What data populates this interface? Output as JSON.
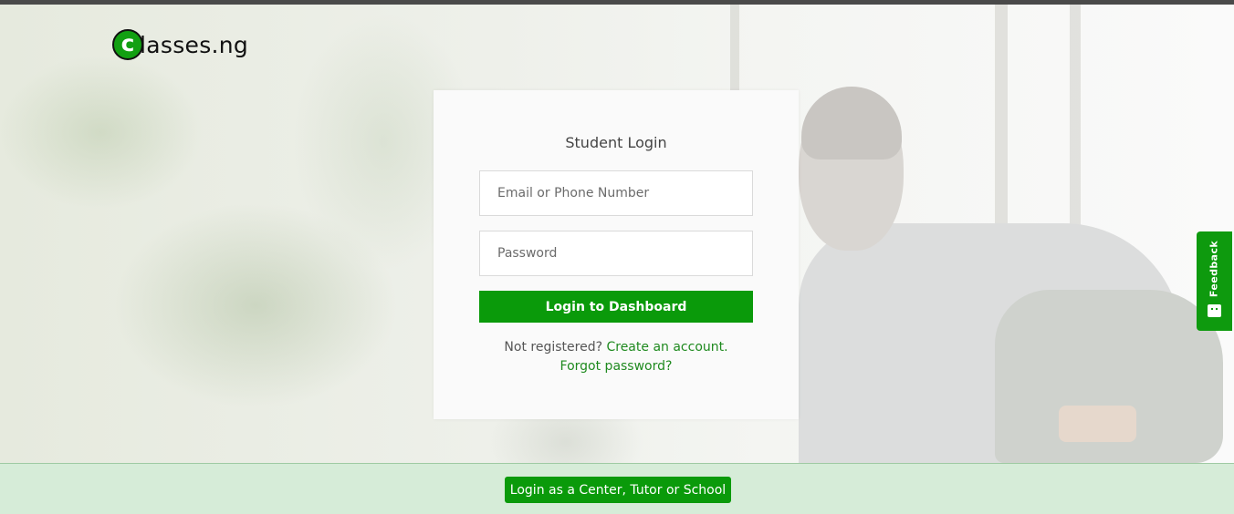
{
  "logo": {
    "letter": "c",
    "text": "lasses.ng",
    "icon": "classes-ng-logo"
  },
  "login_card": {
    "title": "Student Login",
    "email_placeholder": "Email or Phone Number",
    "password_placeholder": "Password",
    "submit_label": "Login to Dashboard",
    "not_registered_text": "Not registered?",
    "create_account_link": "Create an account.",
    "forgot_password_link": "Forgot password?"
  },
  "bottom_bar": {
    "alt_login_label": "Login as a Center, Tutor or School"
  },
  "feedback_tab": {
    "label": "Feedback",
    "icon": "feedback-face-icon"
  },
  "colors": {
    "brand_green": "#0a9a0a",
    "bottom_bar_bg": "#d6ecd8"
  }
}
